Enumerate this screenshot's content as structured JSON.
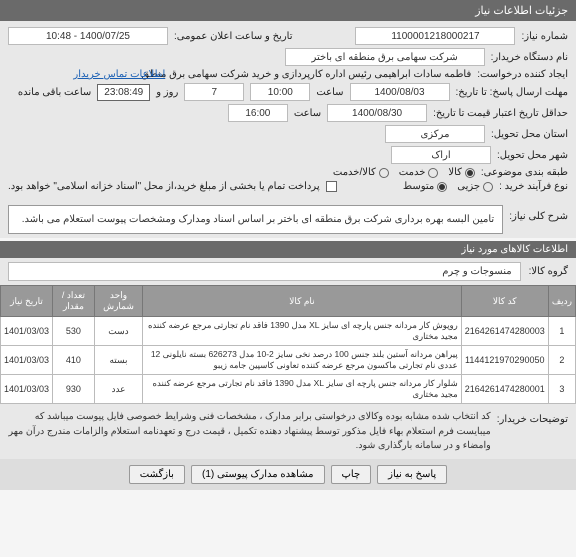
{
  "header": {
    "title": "جزئیات اطلاعات نیاز"
  },
  "form": {
    "request_no_label": "شماره نیاز:",
    "request_no": "1100001218000217",
    "announce_label": "تاریخ و ساعت اعلان عمومی:",
    "announce_value": "1400/07/25 - 10:48",
    "org_label": "نام دستگاه خریدار:",
    "org_value": "شرکت سهامی برق منطقه ای باختر",
    "creator_label": "ایجاد کننده درخواست:",
    "creator_value": "فاطمه سادات ابراهیمی رئیس اداره کارپردازی و خرید شرکت سهامی برق منطق",
    "contact_link": "اطلاعات تماس خریدار",
    "deadline_label": "مهلت ارسال پاسخ: تا تاریخ:",
    "deadline_date": "1400/08/03",
    "time_label": "ساعت",
    "deadline_time": "10:00",
    "remaining_days": "7",
    "remaining_days_label": "روز و",
    "remaining_time": "23:08:49",
    "remaining_suffix": "ساعت باقی مانده",
    "validity_label": "حداقل تاریخ اعتبار قیمت تا تاریخ:",
    "validity_date": "1400/08/30",
    "validity_time": "16:00",
    "province_label": "استان محل تحویل:",
    "province_value": "مرکزی",
    "city_label": "شهر محل تحویل:",
    "city_value": "اراک",
    "category_label": "طبقه بندی موضوعی:",
    "cat_goods": "کالا",
    "cat_service": "خدمت",
    "cat_both": "کالا/خدمت",
    "process_label": "نوع فرآیند خرید :",
    "proc_small": "جزیی",
    "proc_medium": "متوسط",
    "payment_note": "پرداخت تمام یا بخشی از مبلغ خرید،از محل \"اسناد خزانه اسلامی\" خواهد بود.",
    "checkbox_label": ""
  },
  "desc": {
    "label": "شرح کلی نیاز:",
    "text": "تامین البسه بهره برداری شرکت برق منطقه ای باختر بر اساس اسناد ومدارک ومشخصات پیوست استعلام می باشد."
  },
  "goods": {
    "section_title": "اطلاعات کالاهای مورد نیاز",
    "group_label": "گروه کالا:",
    "group_value": "منسوجات و چرم"
  },
  "table": {
    "headers": {
      "row": "ردیف",
      "code": "کد کالا",
      "name": "نام کالا",
      "unit": "واحد شمارش",
      "qty": "تعداد / مقدار",
      "date": "تاریخ نیاز"
    },
    "rows": [
      {
        "idx": "1",
        "code": "2164261474280003",
        "name": "روپوش کار مردانه جنس پارچه ای سایز XL مدل 1390 فاقد نام تجارتی مرجع عرضه کننده مجید مختاری",
        "unit": "دست",
        "qty": "530",
        "date": "1401/03/03"
      },
      {
        "idx": "2",
        "code": "1144121970290050",
        "name": "پیراهن مردانه آستین بلند جنس 100 درصد نخی سایز 2-10 مدل 626273 بسته نایلونی 12 عددی نام تجارتی ماکسون مرجع عرضه کننده تعاونی کاسپین جامه زیبو",
        "unit": "بسته",
        "qty": "410",
        "date": "1401/03/03"
      },
      {
        "idx": "3",
        "code": "2164261474280001",
        "name": "شلوار کار مردانه جنس پارچه ای سایز XL مدل 1390 فاقد نام تجارتی مرجع عرضه کننده مجید مختاری",
        "unit": "عدد",
        "qty": "930",
        "date": "1401/03/03"
      }
    ]
  },
  "footer": {
    "buyer_note_label": "توضیحات خریدار:",
    "buyer_note_text": "کد انتخاب شده مشابه بوده وکالای درخواستی برابر مدارک ، مشخصات فنی وشرایط خصوصی فایل پیوست میباشد که میبایست فرم استعلام بهاء فایل مذکور توسط پیشنهاد دهنده تکمیل ، قیمت درج و تعهدنامه استعلام والزامات  مندرج درآن مهر وامضاء و در سامانه بارگذاری شود."
  },
  "buttons": {
    "answer": "پاسخ به نیاز",
    "copy": "چاپ",
    "docs": "مشاهده مدارک پیوستی  (1)",
    "back": "بازگشت"
  }
}
